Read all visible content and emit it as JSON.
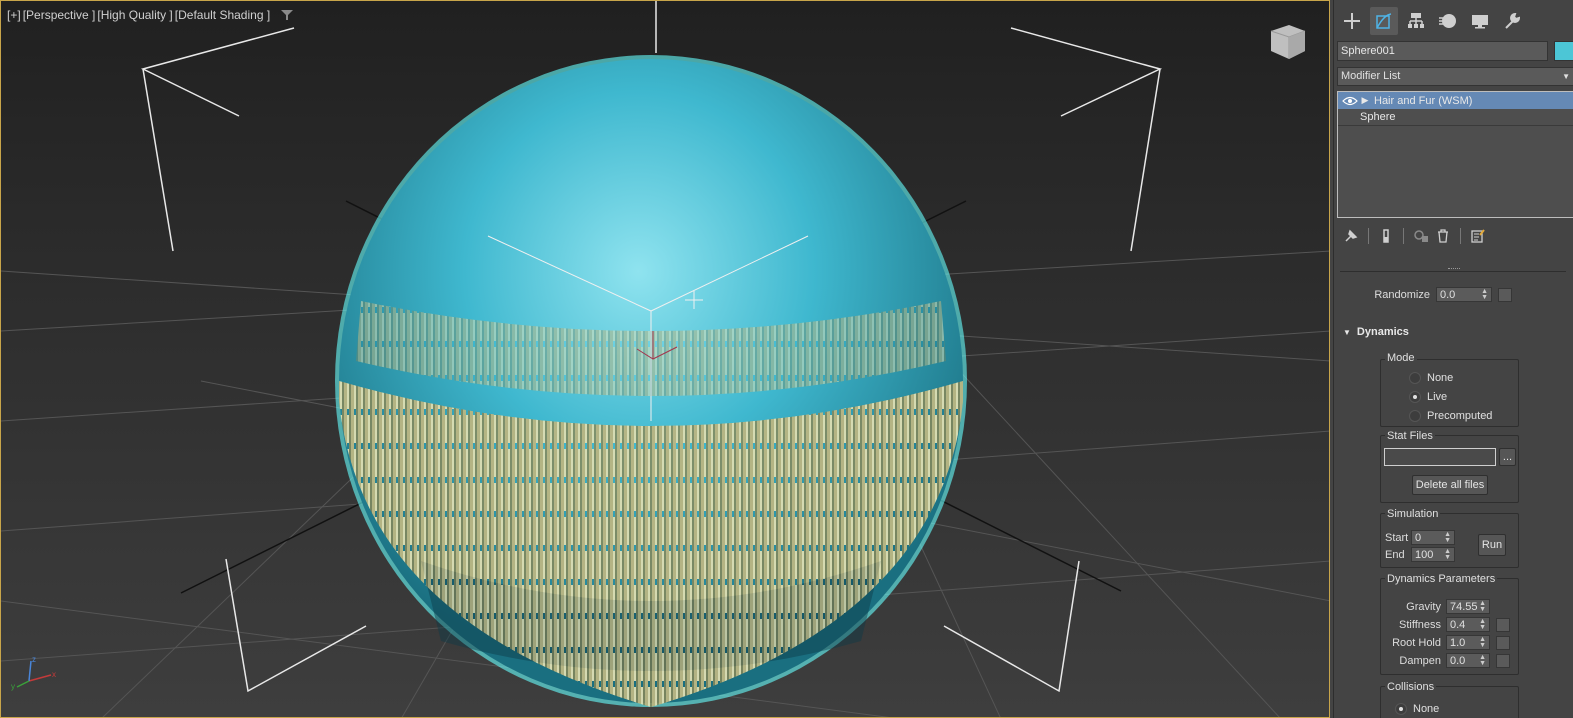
{
  "viewport": {
    "labels": [
      "[+]",
      "[Perspective ]",
      "[High Quality ]",
      "[Default Shading ]"
    ],
    "axes": {
      "x": "x",
      "y": "y",
      "z": "z"
    }
  },
  "panel": {
    "tabs": [
      "create-tab",
      "modify-tab",
      "hierarchy-tab",
      "motion-tab",
      "display-tab",
      "utilities-tab"
    ],
    "object_name": "Sphere001",
    "object_color": "#4cc6d6",
    "modifier_list_label": "Modifier List",
    "modifier_list_arrow": "▼",
    "stack": {
      "items": [
        {
          "label": "Hair and Fur (WSM)"
        },
        {
          "label": "Sphere"
        }
      ]
    },
    "randomize": {
      "label": "Randomize",
      "value": "0.0"
    },
    "dynamics": {
      "title": "Dynamics",
      "mode": {
        "title": "Mode",
        "options": [
          "None",
          "Live",
          "Precomputed"
        ],
        "selected": "Live"
      },
      "stat_files": {
        "title": "Stat Files",
        "value": "",
        "browse_label": "...",
        "delete_label": "Delete all files"
      },
      "simulation": {
        "title": "Simulation",
        "start_label": "Start",
        "start_value": "0",
        "end_label": "End",
        "end_value": "100",
        "run_label": "Run"
      },
      "params": {
        "title": "Dynamics Parameters",
        "gravity_label": "Gravity",
        "gravity_value": "74.55",
        "stiffness_label": "Stiffness",
        "stiffness_value": "0.4",
        "roothold_label": "Root Hold",
        "roothold_value": "1.0",
        "dampen_label": "Dampen",
        "dampen_value": "0.0"
      },
      "collisions": {
        "title": "Collisions",
        "first_option": "None"
      }
    }
  }
}
